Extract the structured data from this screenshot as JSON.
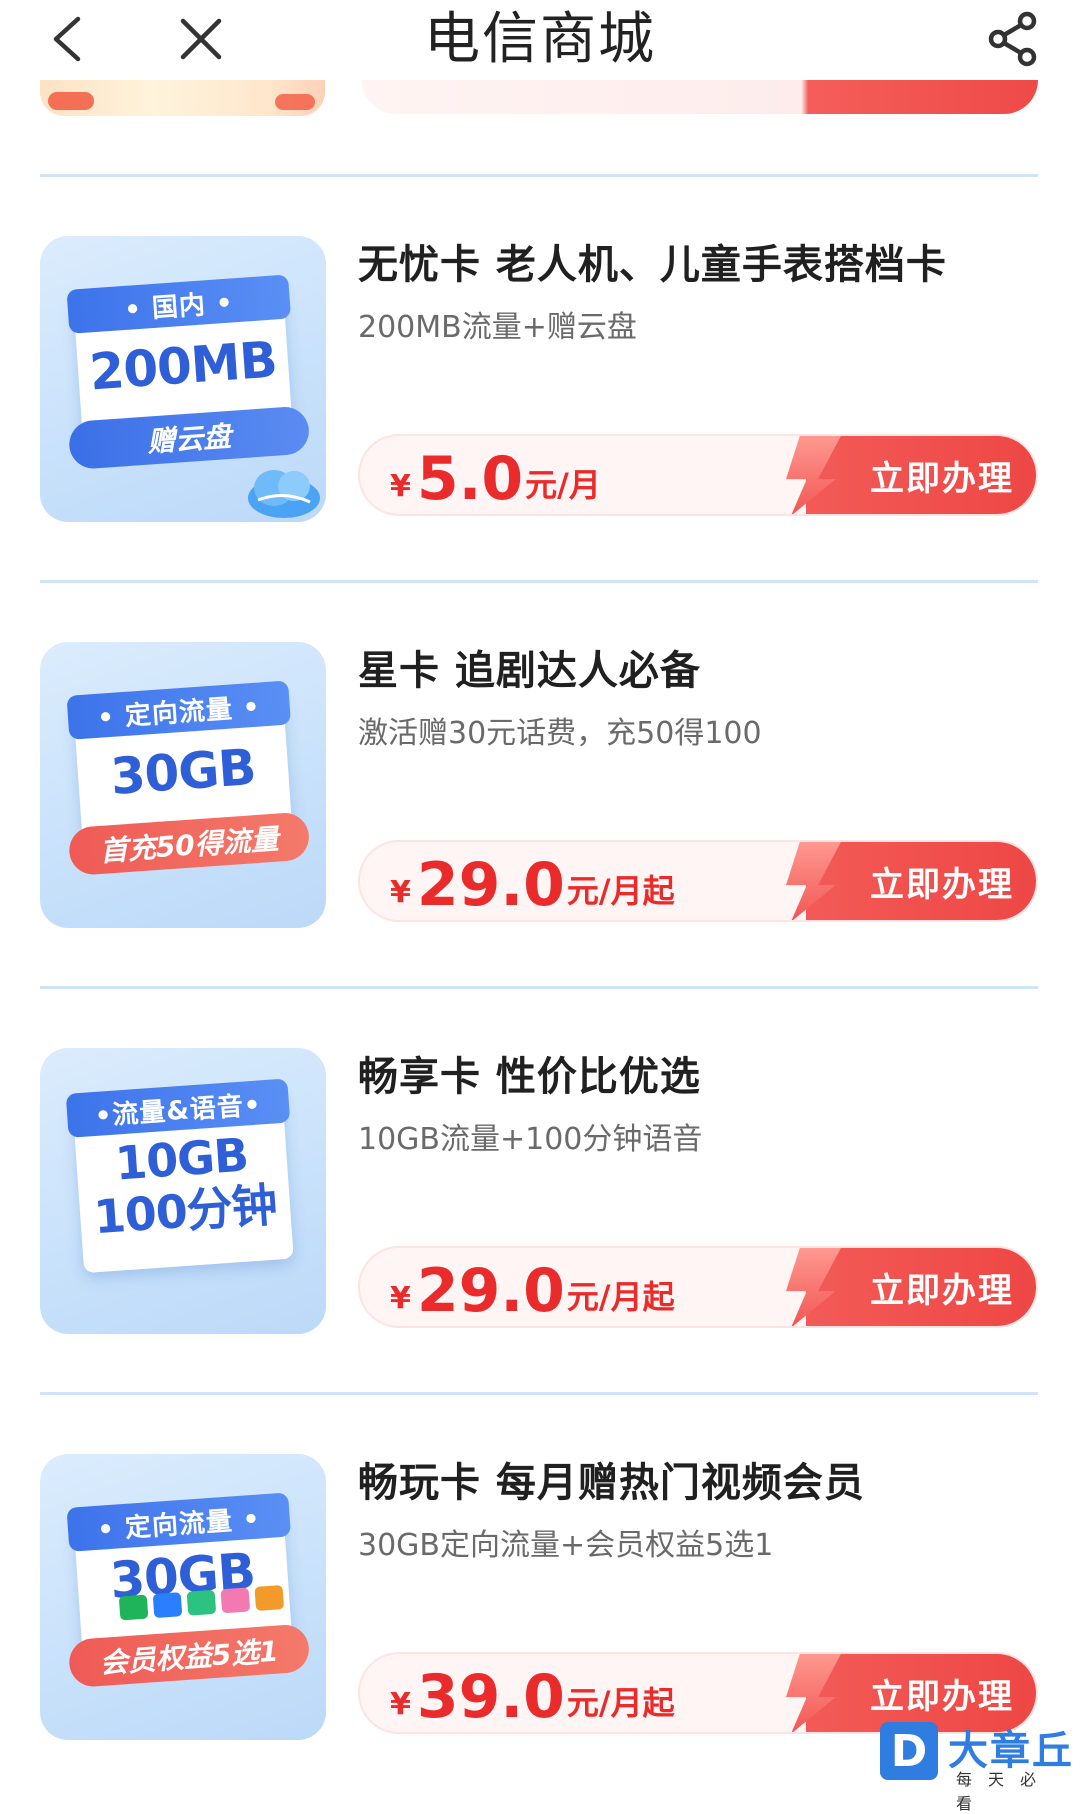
{
  "header": {
    "title": "电信商城",
    "back_icon": "chevron-left-icon",
    "close_icon": "close-icon",
    "share_icon": "share-icon"
  },
  "currency_symbol": "¥",
  "cta_label": "立即办理",
  "products": [
    {
      "title": "无忧卡 老人机、儿童手表搭档卡",
      "subtitle": "200MB流量+赠云盘",
      "price": "5.0",
      "unit": "元/月",
      "image": {
        "header": "• 国内 •",
        "main": "200MB",
        "main2": "",
        "pill": "赠云盘",
        "pill_color": "blue"
      }
    },
    {
      "title": "星卡 追剧达人必备",
      "subtitle": "激活赠30元话费，充50得100",
      "price": "29.0",
      "unit": "元/月起",
      "image": {
        "header": "• 定向流量 •",
        "main": "30GB",
        "main2": "",
        "pill": "首充50得流量",
        "pill_color": "red"
      }
    },
    {
      "title": "畅享卡 性价比优选",
      "subtitle": "10GB流量+100分钟语音",
      "price": "29.0",
      "unit": "元/月起",
      "image": {
        "header": "•流量&语音•",
        "main": "10GB",
        "main2": "100分钟",
        "pill": "",
        "pill_color": ""
      }
    },
    {
      "title": "畅玩卡 每月赠热门视频会员",
      "subtitle": "30GB定向流量+会员权益5选1",
      "price": "39.0",
      "unit": "元/月起",
      "image": {
        "header": "• 定向流量 •",
        "main": "30GB",
        "main2": "",
        "pill": "会员权益5选1",
        "pill_color": "red"
      }
    }
  ],
  "watermark": {
    "logo": "D",
    "name": "大章丘",
    "slogan": "每天必看"
  },
  "colors": {
    "price_red": "#ea2b2b",
    "cta_red": "#ee4745",
    "divider_blue": "#cfe5f7",
    "ticket_blue": "#3d73ea"
  }
}
